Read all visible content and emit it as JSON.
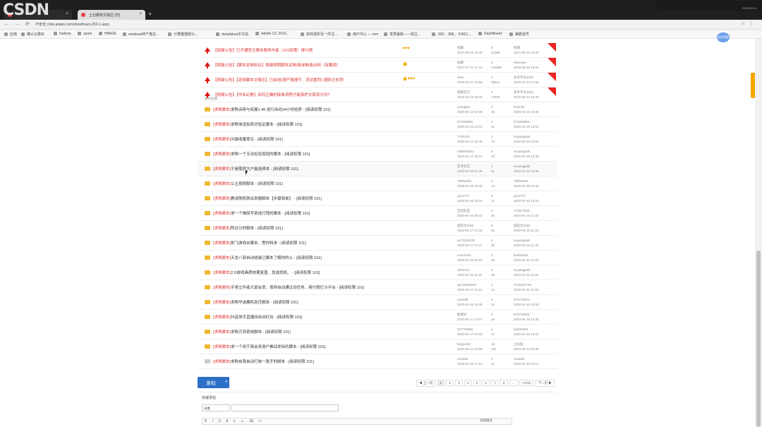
{
  "browser": {
    "tabs": [
      {
        "label": ""
      },
      {
        "label": "土壮脚本交易区 [作]"
      }
    ],
    "url": "不安全 | bbs.anjian.com/showforum-253-1.aspx",
    "tray_time": "2020/04/18",
    "bookmarks": [
      "应用",
      "确认记录好",
      "hadoop",
      "spark",
      "HBASE",
      "windows终产像位...",
      "计算整理统计...",
      "deepfakes中文站",
      "Adobe CC 2019...",
      "如何进阶写一件注...",
      "用户中心 — mm",
      "发表最新——助立...",
      "JDK、JRE、JVM三...",
      "DashBoard",
      "美剧追号"
    ]
  },
  "watermark": "CSDN",
  "announcements": [
    {
      "title": "【按键公告】已开通官方脚本服务作者（101权限）排行榜",
      "stars": "♥♥♥",
      "author": "按键",
      "author_date": "2017-05-31 16:30",
      "replies": "0",
      "views": "21065",
      "last_user": "按键",
      "last_date": "2017-05-31 16:30"
    },
    {
      "title": "【按键公告】【脚本定制协议】按键按照脚本定制/接单制造出网（有要闻）",
      "stars": "👍",
      "author": "按键",
      "author_date": "2017-07-21 17:41",
      "replies": "0",
      "views": "133985",
      "last_user": "hlasanke",
      "last_date": "2018-05-19 16:26"
    },
    {
      "title": "【按键公告】【定制脚本交易区】已启用(请严格遵守、违法重罚) 谨防过去罚!",
      "stars": "👍♥♥♥",
      "author": "anso",
      "author_date": "2016-04-27 16:58",
      "replies": "4",
      "views": "38821",
      "last_user": "技术专员2022",
      "last_date": "2018-07-16 17:59"
    },
    {
      "title": "【按键公告】【作业必看】如何正确的接单流程才能保护交易双方吗?",
      "stars": "",
      "author": "按键官方",
      "author_date": "2015-10-14 18:20",
      "replies": "4",
      "views": "17620",
      "last_user": "技术专员2022",
      "last_date": "2019-05-14 16:20"
    }
  ],
  "section_label": "板块主题",
  "threads": [
    {
      "tag": "[求购脚本]",
      "title": "求购诗奇与拓展1.45 进行自动24小时给房",
      "suffix": "- [阅读权限 101]",
      "author": "yuangfen",
      "author_date": "2020-04-18 12:08",
      "replies": "2",
      "views": "16",
      "last_user": "husinke",
      "last_date": "2020-04-18 13:36"
    },
    {
      "tag": "[求购脚本]",
      "title": "求购淘宝拍卖对验证脚本",
      "suffix": "- [阅读权限 101]",
      "author": "971568804",
      "author_date": "2020-04-18 12:01",
      "replies": "4",
      "views": "11",
      "last_user": "971568804",
      "last_date": "2020-04-18 13:04"
    },
    {
      "tag": "[求购脚本]",
      "title": "问最收量意见",
      "suffix": "- [阅读权限 101]",
      "author": "7700140",
      "author_date": "2020-04-17 16:49",
      "replies": "2",
      "views": "70",
      "last_user": "xiuyangjiale",
      "last_date": "2020-04-18 12:52"
    },
    {
      "tag": "[求购脚本]",
      "title": "求购一个无法检验按钮的脚本",
      "suffix": "- [阅读权限 101]",
      "author": "nbbleed001",
      "author_date": "2020-04-17 15:21",
      "replies": "4",
      "views": "43",
      "last_user": "xiuyangjiale",
      "last_date": "2020-04-18 12:49"
    },
    {
      "tag": "[求购脚本]",
      "title": "于是需值大户能选择本",
      "suffix": "- [阅读权限 101]",
      "author": "亚寻东宫",
      "author_date": "2020-03-09 01:46",
      "replies": "4",
      "views": "61",
      "last_user": "xiuyangjiale",
      "last_date": "2020-04-18 12:45"
    },
    {
      "tag": "[求购脚本]",
      "title": "公主按按脚本",
      "suffix": "- [阅读权限 101]",
      "author": "78692630",
      "author_date": "2020-04-18 12:40",
      "replies": "0",
      "views": "13",
      "last_user": "78692630",
      "last_date": "2020-04-18 12:40"
    },
    {
      "tag": "[求购脚本]",
      "title": "教说随机刷出来撤脚本【步骤简单】",
      "suffix": "- [阅读权限 101]",
      "author": "yyzu773",
      "author_date": "2020-04-18 12:03",
      "replies": "0",
      "views": "11",
      "last_user": "yyzu773",
      "last_date": "2020-04-18 12:03"
    },
    {
      "tag": "[求购脚本]",
      "title": "求一个佛段写奇迹打怪的脚本",
      "suffix": "- [阅读权限 101]",
      "author": "百思此是",
      "author_date": "2020-04-16 09:10",
      "replies": "4",
      "views": "35",
      "last_user": "372927500",
      "last_date": "2020-04-18 11:40"
    },
    {
      "tag": "[求购脚本]",
      "title": "阿达分的脚本",
      "suffix": "- [阅读权限 101]",
      "author": "越是太么88",
      "author_date": "2020-04-17 14:33",
      "replies": "5",
      "views": "66",
      "last_user": "越是太么88",
      "last_date": "2020-04-18 11:33"
    },
    {
      "tag": "[求购脚本]",
      "title": "射飞游戏台脚本、悉你特本",
      "suffix": "- [阅读权限 101]",
      "author": "a474155130",
      "author_date": "2020-04-17 14:21",
      "replies": "4",
      "views": "30",
      "last_user": "xiuyangjiale",
      "last_date": "2020-04-18 11:33"
    },
    {
      "tag": "[求购脚本]",
      "title": "天龙八部自动收装已脚本了解你的么",
      "suffix": "- [阅读权限 101]",
      "author": "xue13494",
      "author_date": "2020-04-18 03:54",
      "replies": "2",
      "views": "26",
      "last_user": "laoban521",
      "last_date": "2020-04-18 11:33"
    },
    {
      "tag": "[求购脚本]",
      "title": "2 D游戏画质效果复盖、急成找机、",
      "suffix": "- [阅读权限 101]",
      "author": "4820751",
      "author_date": "2020-04-18 11:22",
      "replies": "4",
      "views": "48",
      "last_user": "xiuyangjiale",
      "last_date": "2020-04-18 11:34"
    },
    {
      "tag": "[求购脚本]",
      "title": "平哥立件者大鼠会员、按得自动通过动任务、商付按打沙平台",
      "suffix": "- [阅读权限 101]",
      "author": "q1236686931",
      "author_date": "2020-04-17 14:24",
      "replies": "2",
      "views": "44",
      "last_user": "4146220749",
      "last_date": "2020-04-18 11:03"
    },
    {
      "tag": "[求购脚本]",
      "title": "求购华选模机各任脚本",
      "suffix": "- [阅读权限 101]",
      "author": "yaxi498",
      "author_date": "2020-04-18 10:46",
      "replies": "5",
      "views": "32",
      "last_user": "873719623",
      "last_date": "2020-04-18 10:55"
    },
    {
      "tag": "[求购脚本]",
      "title": "抖音快手直播间自动红包",
      "suffix": "- [阅读权限 101]",
      "author": "能根好",
      "author_date": "2020-04-17 14:07",
      "replies": "4",
      "views": "18",
      "last_user": "873719623",
      "last_date": "2020-04-18 10:46"
    },
    {
      "tag": "[求购脚本]",
      "title": "求购万剑奇侠脚本",
      "suffix": "- [阅读权限 101]",
      "author": "527705060",
      "author_date": "2020-04-17 21:03",
      "replies": "4",
      "views": "17",
      "last_user": "laoban521",
      "last_date": "2020-04-18 10:22"
    },
    {
      "tag": "[求购脚本]",
      "title": "求一个用于商会发用户推动发标的脚本",
      "suffix": "- [阅读权限 101]",
      "author": "lengyi110",
      "author_date": "2020-04-14 16:58",
      "replies": "18",
      "views": "161",
      "last_user": "尘米团",
      "last_date": "2020-04-14 00:38"
    },
    {
      "tag": "[求购脚本]",
      "title": "求购自我自动打单一款手的脚本",
      "suffix": "- [阅读权限 101]",
      "author": "xow8de",
      "author_date": "2020-04-18 17:10",
      "replies": "0",
      "views": "11",
      "last_user": "xow8de",
      "last_date": "2020-04-18 01:11"
    }
  ],
  "post_button": "发帖",
  "pager": {
    "prev": "◀ 上一页",
    "pages": [
      "1",
      "2",
      "3",
      "4",
      "5",
      "6",
      "7",
      "8",
      "..."
    ],
    "jump": "/ 3710",
    "next": "下一页 ▶"
  },
  "quick_post": {
    "title": "快速发帖",
    "select_value": "分类",
    "toolbar": "B I U A ≡ ☺ ⌧ ↩",
    "right": "高级模式"
  },
  "float_label": "返回顶部"
}
